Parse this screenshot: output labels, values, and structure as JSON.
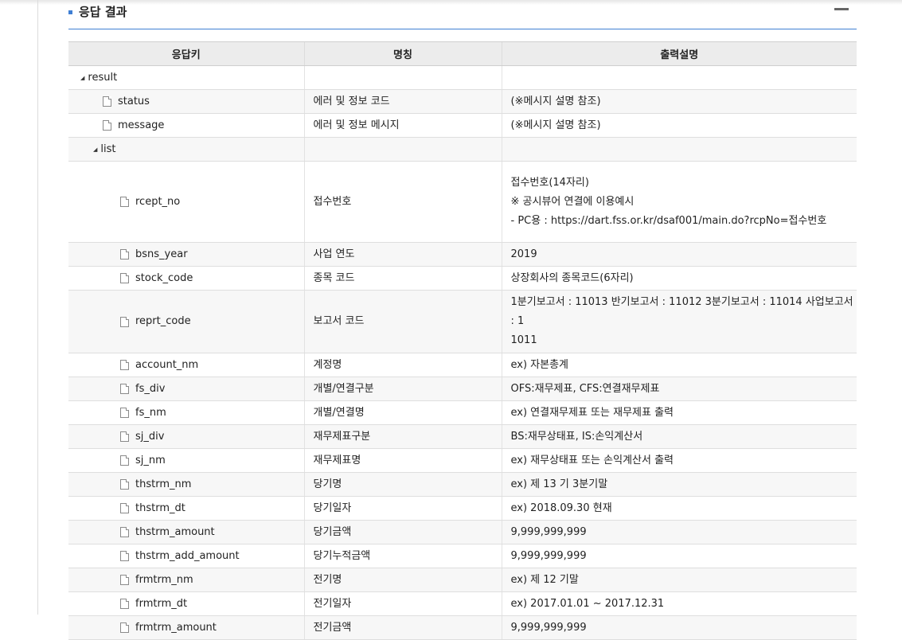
{
  "section": {
    "title": "응답 결과"
  },
  "table": {
    "headers": [
      "응답키",
      "명칭",
      "출력설명"
    ],
    "rows": [
      {
        "key": "result",
        "name": "",
        "desc": ""
      },
      {
        "key": "status",
        "name": "에러 및 정보 코드",
        "desc": "(※메시지 설명 참조)"
      },
      {
        "key": "message",
        "name": "에러 및 정보 메시지",
        "desc": "(※메시지 설명 참조)"
      },
      {
        "key": "list",
        "name": "",
        "desc": ""
      },
      {
        "key": "rcept_no",
        "name": "접수번호",
        "desc_lines": [
          "접수번호(14자리)",
          "",
          "※ 공시뷰어 연결에 이용예시",
          "- PC용 : https://dart.fss.or.kr/dsaf001/main.do?rcpNo=접수번호"
        ]
      },
      {
        "key": "bsns_year",
        "name": "사업 연도",
        "desc": "2019"
      },
      {
        "key": "stock_code",
        "name": "종목 코드",
        "desc": "상장회사의 종목코드(6자리)"
      },
      {
        "key": "reprt_code",
        "name": "보고서 코드",
        "desc_lines": [
          "1분기보고서 : 11013 반기보고서 : 11012 3분기보고서 : 11014 사업보고서 : 1",
          "1011"
        ]
      },
      {
        "key": "account_nm",
        "name": "계정명",
        "desc": "ex) 자본총계"
      },
      {
        "key": "fs_div",
        "name": "개별/연결구분",
        "desc": "OFS:재무제표, CFS:연결재무제표"
      },
      {
        "key": "fs_nm",
        "name": "개별/연결명",
        "desc": "ex) 연결재무제표 또는 재무제표 출력"
      },
      {
        "key": "sj_div",
        "name": "재무제표구분",
        "desc": "BS:재무상태표, IS:손익계산서"
      },
      {
        "key": "sj_nm",
        "name": "재무제표명",
        "desc": "ex) 재무상태표 또는 손익계산서 출력"
      },
      {
        "key": "thstrm_nm",
        "name": "당기명",
        "desc": "ex) 제 13 기 3분기말"
      },
      {
        "key": "thstrm_dt",
        "name": "당기일자",
        "desc": "ex) 2018.09.30 현재"
      },
      {
        "key": "thstrm_amount",
        "name": "당기금액",
        "desc": "9,999,999,999"
      },
      {
        "key": "thstrm_add_amount",
        "name": "당기누적금액",
        "desc": "9,999,999,999"
      },
      {
        "key": "frmtrm_nm",
        "name": "전기명",
        "desc": "ex) 제 12 기말"
      },
      {
        "key": "frmtrm_dt",
        "name": "전기일자",
        "desc": "ex) 2017.01.01 ~ 2017.12.31"
      },
      {
        "key": "frmtrm_amount",
        "name": "전기금액",
        "desc": "9,999,999,999"
      }
    ]
  }
}
